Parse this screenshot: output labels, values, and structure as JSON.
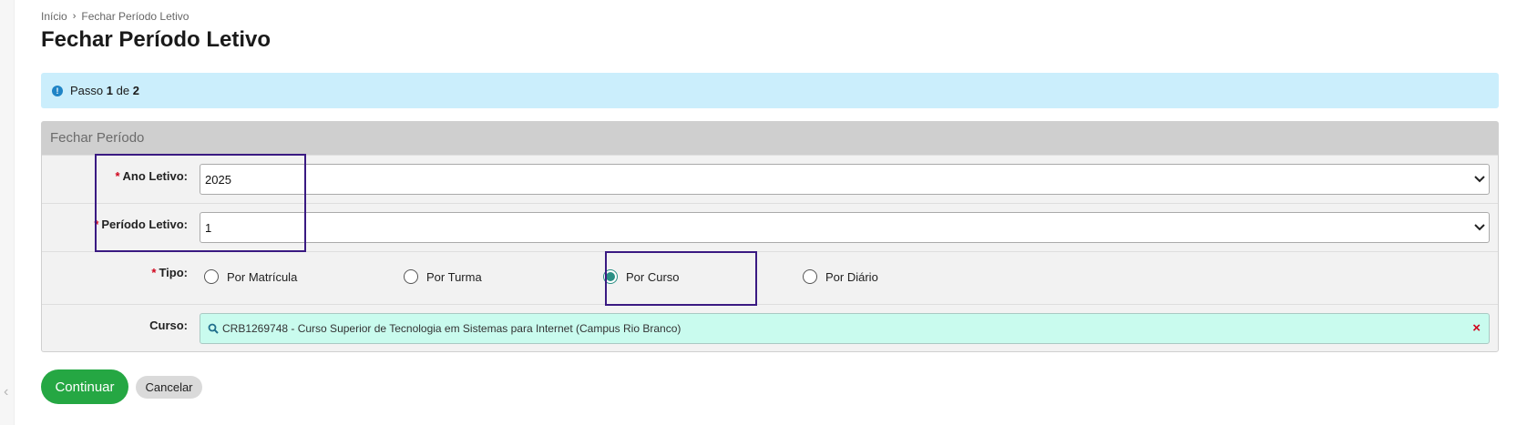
{
  "breadcrumb": {
    "home": "Início",
    "current": "Fechar Período Letivo"
  },
  "page": {
    "title": "Fechar Período Letivo"
  },
  "alert": {
    "prefix": "Passo",
    "step": "1",
    "middle": "de",
    "total": "2"
  },
  "panel": {
    "title": "Fechar Período",
    "ano_letivo": {
      "label": "Ano Letivo:",
      "value": "2025"
    },
    "periodo_letivo": {
      "label": "Período Letivo:",
      "value": "1"
    },
    "tipo": {
      "label": "Tipo:",
      "options": [
        "Por Matrícula",
        "Por Turma",
        "Por Curso",
        "Por Diário"
      ],
      "selected": "Por Curso"
    },
    "curso": {
      "label": "Curso:",
      "value": "CRB1269748 - Curso Superior de Tecnologia em Sistemas para Internet (Campus Rio Branco)"
    }
  },
  "actions": {
    "continue": "Continuar",
    "cancel": "Cancelar"
  },
  "colors": {
    "alert_bg": "#cbeefc",
    "primary_button": "#25a743",
    "radio_checked": "#2a8f84",
    "highlight_box": "#3a1a82",
    "required_mark": "#d0021b"
  }
}
